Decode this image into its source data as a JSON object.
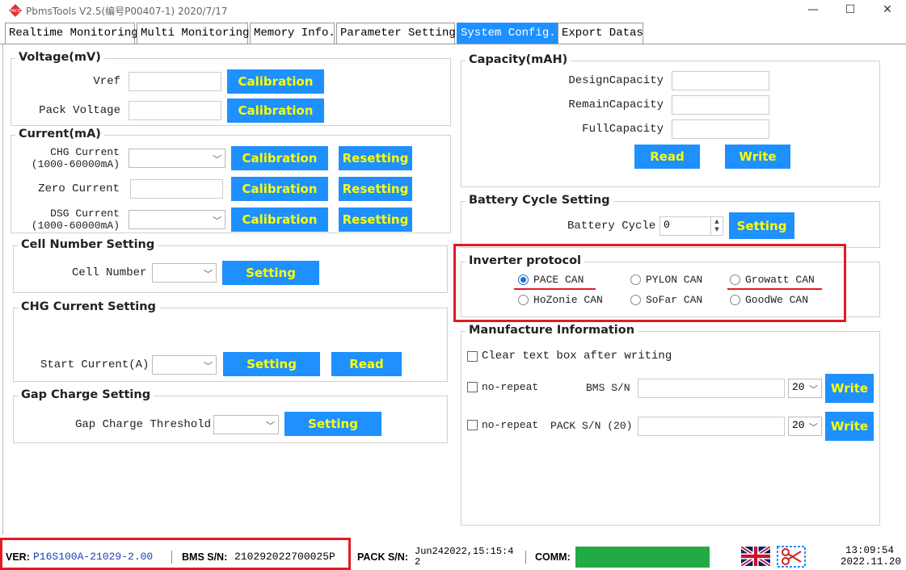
{
  "window": {
    "title": "PbmsTools V2.5(编号P00407-1)  2020/7/17",
    "minimize": "—",
    "maximize": "☐",
    "close": "✕"
  },
  "tabs": [
    {
      "label": "Realtime Monitoring"
    },
    {
      "label": "Multi Monitoring"
    },
    {
      "label": "Memory Info."
    },
    {
      "label": "Parameter Setting"
    },
    {
      "label": "System Config.",
      "active": true
    },
    {
      "label": "Export Datas"
    }
  ],
  "voltage": {
    "title": "Voltage(mV)",
    "vref_label": "Vref",
    "vref_value": "",
    "pack_label": "Pack Voltage",
    "pack_value": "",
    "calibration": "Calibration"
  },
  "current": {
    "title": "Current(mA)",
    "chg_label_1": "CHG Current",
    "chg_label_2": "(1000-60000mA)",
    "chg_value": "",
    "zero_label": "Zero Current",
    "zero_value": "",
    "dsg_label_1": "DSG Current",
    "dsg_label_2": "(1000-60000mA)",
    "dsg_value": "",
    "calibration": "Calibration",
    "resetting": "Resetting"
  },
  "cell_number": {
    "title": "Cell Number Setting",
    "label": "Cell Number",
    "value": "",
    "button": "Setting"
  },
  "chg_current_setting": {
    "title": "CHG Current Setting",
    "label": "Start Current(A)",
    "value": "",
    "setting": "Setting",
    "read": "Read"
  },
  "gap_charge": {
    "title": "Gap Charge Setting",
    "label": "Gap Charge Threshold",
    "value": "",
    "button": "Setting"
  },
  "capacity": {
    "title": "Capacity(mAH)",
    "design_label": "DesignCapacity",
    "design_value": "",
    "remain_label": "RemainCapacity",
    "remain_value": "",
    "full_label": "FullCapacity",
    "full_value": "",
    "read": "Read",
    "write": "Write"
  },
  "battery_cycle": {
    "title": "Battery Cycle Setting",
    "label": "Battery Cycle",
    "value": "0",
    "button": "Setting"
  },
  "inverter": {
    "title": "Inverter protocol",
    "options": [
      {
        "label": "PACE CAN",
        "selected": true
      },
      {
        "label": "PYLON CAN",
        "selected": false
      },
      {
        "label": "Growatt CAN",
        "selected": false
      },
      {
        "label": "HoZonie CAN",
        "selected": false
      },
      {
        "label": "SoFar CAN",
        "selected": false
      },
      {
        "label": "GoodWe CAN",
        "selected": false
      }
    ]
  },
  "manufacture": {
    "title": "Manufacture Information",
    "clear_label": "Clear text box after writing",
    "no_repeat": "no-repeat",
    "bms_sn_label": "BMS S/N",
    "bms_sn_value": "",
    "bms_len": "20",
    "pack_sn_label": "PACK S/N (20)",
    "pack_sn_value": "",
    "pack_len": "20",
    "write": "Write"
  },
  "status": {
    "ver_label": "VER:",
    "ver_value": "P16S100A-21029-2.00",
    "bms_label": "BMS S/N:",
    "bms_value": "210292022700025P",
    "pack_label": "PACK S/N:",
    "pack_value_1": "Jun242022,15:15:4",
    "pack_value_2": "2",
    "comm_label": "COMM:",
    "comm_color": "#22aa44",
    "time": "13:09:54",
    "date": "2022.11.20"
  },
  "colors": {
    "button_bg": "#1e90ff",
    "button_text": "#ffff00",
    "highlight": "#e01b24"
  }
}
